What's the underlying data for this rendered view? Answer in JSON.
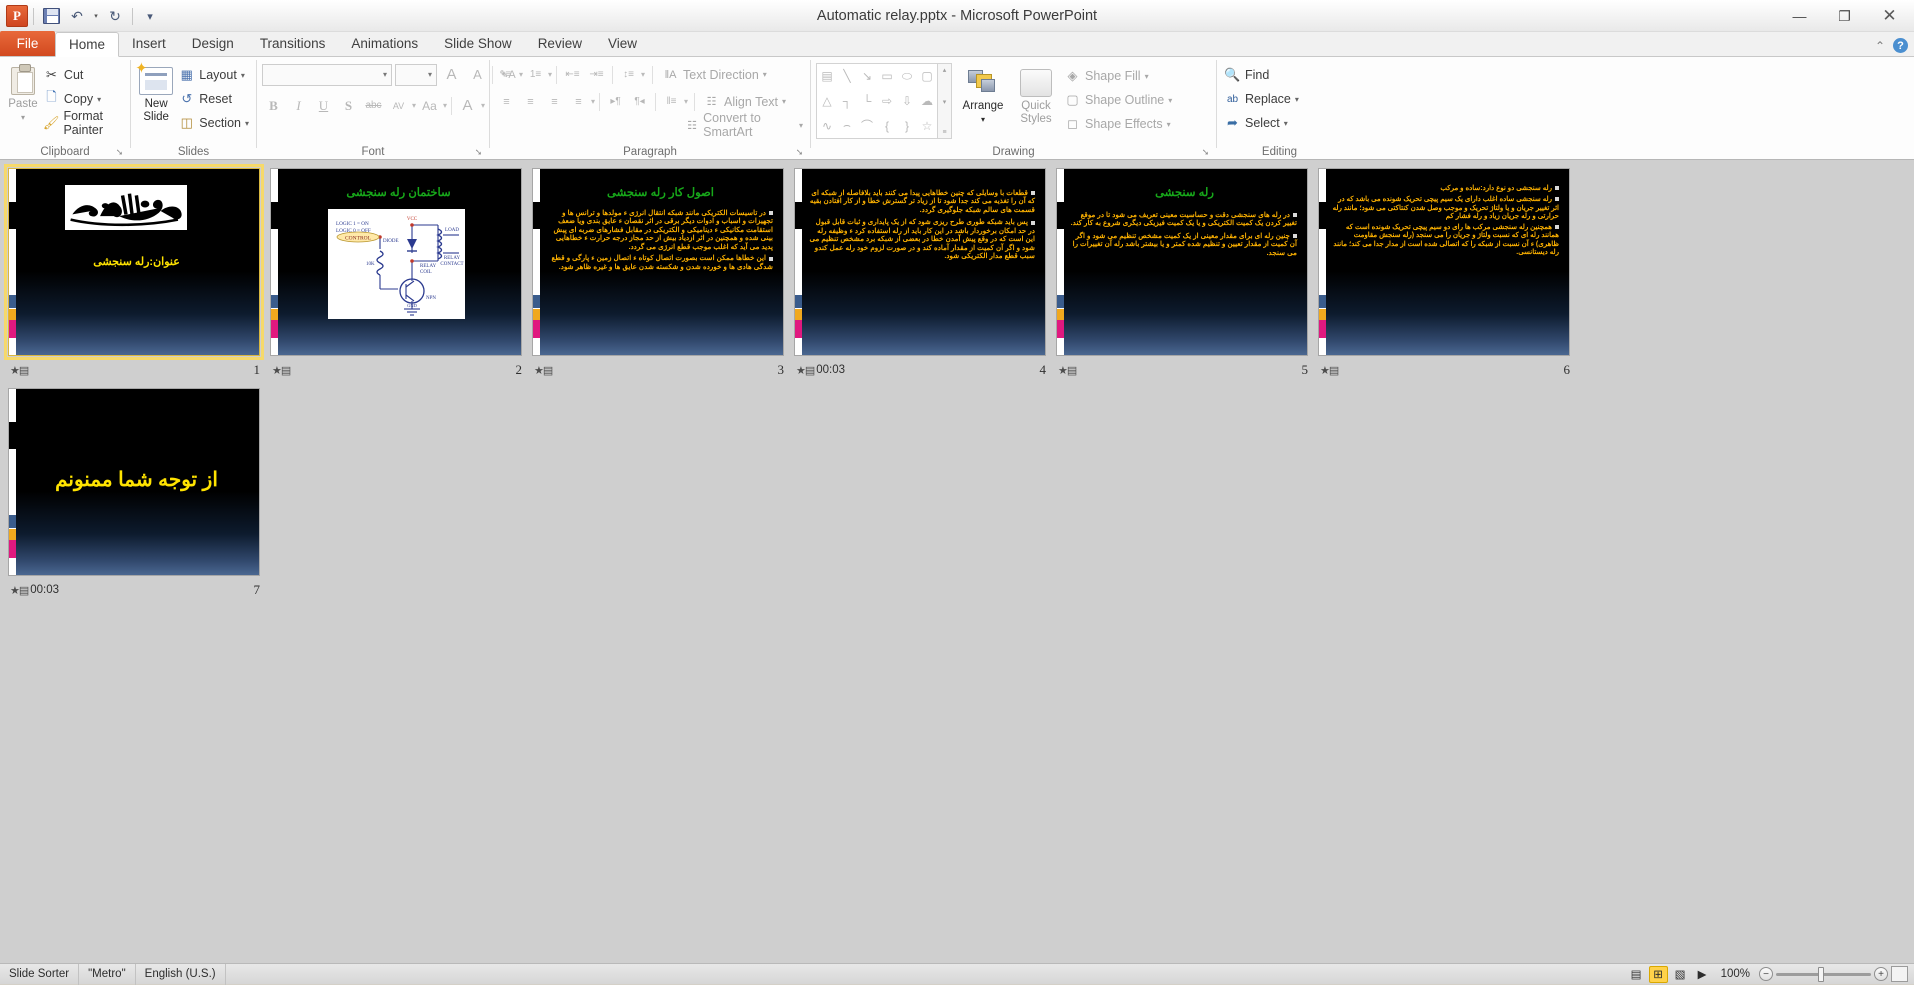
{
  "window": {
    "title": "Automatic relay.pptx  -  Microsoft PowerPoint",
    "minimize": "—",
    "restore": "❐",
    "close": "✕"
  },
  "quick_access": {
    "app_logo": "P",
    "save": "save-icon",
    "undo": "↶",
    "undo_arrow": "▾",
    "redo": "↻",
    "customize": "▾"
  },
  "tabs": [
    {
      "label": "File",
      "active": false,
      "file": true
    },
    {
      "label": "Home",
      "active": true
    },
    {
      "label": "Insert",
      "active": false
    },
    {
      "label": "Design",
      "active": false
    },
    {
      "label": "Transitions",
      "active": false
    },
    {
      "label": "Animations",
      "active": false
    },
    {
      "label": "Slide Show",
      "active": false
    },
    {
      "label": "Review",
      "active": false
    },
    {
      "label": "View",
      "active": false
    }
  ],
  "tab_right": {
    "minimize_ribbon": "⌃",
    "help": "?"
  },
  "ribbon": {
    "clipboard": {
      "label": "Clipboard",
      "paste": "Paste",
      "paste_arrow": "▾",
      "cut": "Cut",
      "copy": "Copy",
      "copy_arrow": "▾",
      "format_painter": "Format Painter",
      "launcher": "➘"
    },
    "slides": {
      "label": "Slides",
      "new_slide": "New\nSlide",
      "new_slide_line1": "New",
      "new_slide_line2": "Slide",
      "new_slide_arrow": "▾",
      "layout": "Layout",
      "reset": "Reset",
      "section": "Section",
      "layout_arrow": "▾",
      "section_arrow": "▾"
    },
    "font": {
      "label": "Font",
      "font_name_value": "",
      "font_size_value": "",
      "grow_font": "A",
      "shrink_font": "A",
      "clear_formatting": "A⊘",
      "bold": "B",
      "italic": "I",
      "underline": "U",
      "shadow": "S",
      "strikethrough": "abc",
      "character_spacing": "AV",
      "change_case": "Aa",
      "font_color": "A",
      "launcher": "➘"
    },
    "paragraph": {
      "label": "Paragraph",
      "bullets": "•≡",
      "numbering": "1≡",
      "decrease_indent": "⇤≡",
      "increase_indent": "⇥≡",
      "line_spacing": "↕≡",
      "align_left": "≡",
      "align_center": "≡",
      "align_right": "≡",
      "justify": "≡",
      "ltr": "▸¶",
      "rtl": "¶◂",
      "columns": "‖≡",
      "text_direction": "Text Direction",
      "align_text": "Align Text",
      "convert_to_smartart": "Convert to SmartArt",
      "launcher": "➘"
    },
    "drawing": {
      "label": "Drawing",
      "shapes": [
        "▤",
        "╲",
        "↘",
        "▭",
        "⬭",
        "▢",
        "△",
        "┐",
        "└",
        "⇨",
        "⇩",
        "☁",
        "∿",
        "⌢",
        "⌒",
        "{",
        "}",
        "☆"
      ],
      "gallery_up": "▴",
      "gallery_down": "▾",
      "gallery_more": "≡",
      "arrange": "Arrange",
      "arrange_arrow": "▾",
      "quick_styles_line1": "Quick",
      "quick_styles_line2": "Styles",
      "quick_styles_arrow": "▾",
      "shape_fill": "Shape Fill",
      "shape_outline": "Shape Outline",
      "shape_effects": "Shape Effects",
      "launcher": "➘"
    },
    "editing": {
      "label": "Editing",
      "find": "Find",
      "replace": "Replace",
      "select": "Select",
      "replace_arrow": "▾",
      "select_arrow": "▾"
    }
  },
  "slides": [
    {
      "number": "1",
      "time": "",
      "selected": true,
      "title": "عنوان:رله سنجشی",
      "title_color": "yellow",
      "has_bismillah": true,
      "body": []
    },
    {
      "number": "2",
      "time": "",
      "selected": false,
      "title": "ساختمان رله سنجشی",
      "title_color": "green",
      "has_circuit": true,
      "circuit_labels": {
        "vcc": "VCC",
        "diode": "DIODE",
        "logic1": "LOGIC 1 = ON",
        "logic0": "LOGIC 0 = OFF",
        "control": "CONTROL",
        "resistor": "10K",
        "relay_coil_l1": "RELAY",
        "relay_coil_l2": "COIL",
        "load": "LOAD",
        "relay_contact_l1": "RELAY",
        "relay_contact_l2": "CONTACT",
        "npn": "NPN",
        "gnd": "GND"
      },
      "body": []
    },
    {
      "number": "3",
      "time": "",
      "selected": false,
      "title": "اصول کار رله سنجشی",
      "title_color": "green",
      "body": [
        "در تاسیسات الکتریکی مانند شبکه انتقال انرژی ء مولدها و ترانس ها و تجهیزات و اسباب و ادوات دیگر برقی در اثر نقصان ء عایق بندی ویا ضعف استقامت مکانیکی ء دینامیکی و الکتریکی در مقابل فشارهای ضربه ای پیش بینی شده و همچنین در اثر ازدیاد بیش از حد مجاز درجه حرارت ء خطاهایی پدید می آید که اغلب موجب قطع انرژی می گردد.",
        "این خطاها ممکن است بصورت اتصال کوتاه ء اتصال زمین ء پارگی و قطع شدگی هادی ها و خورده شدن و شکسته شدن عایق ها و غیره ظاهر شود."
      ]
    },
    {
      "number": "4",
      "time": "00:03",
      "selected": false,
      "title": "",
      "title_color": "yellow",
      "body": [
        "قطعات  با وسایلی که چنین خطاهایی پیدا می کنند باید بلافاصله از شبکه ای که   آن را تغذیه می کند جدا شود تا از زیاد تر گسترش خطا و از کار افتادن بقیه قسمت های سالم شبکه جلوگیری گردد.",
        "پس باید شبکه طوری طرح ریزی شود که   از یک  پایداری و ثبات قابل قبول در حد امکان برخوردار باشد در این کار باید از رله استفاده کرد ء وظیفه رله این است که در وقع پیش آمدن خطا در بعضی از شبکه برد مشخص تنظیم می شود و اگر آن کمیت از مقدار آماده کند و در صورت لزوم خود رله عمل کندو سبب قطع مدار الکتریکی شود."
      ]
    },
    {
      "number": "5",
      "time": "",
      "selected": false,
      "title": "رله سنجشی",
      "title_color": "green",
      "body": [
        "در رله های سنجشی دقت و حساسیت معینی تعریف می شود تا در موقع تغییر کردن یک کمیت الکتریکی و یا یک کمیت فیزیکی دیگری شروع به کار کند.",
        "چنین رله ای برای مقدار معینی از یک کمیت مشخص تنظیم می شود  و اگر  آن کمیت از مقدار تعیین و تنظیم شده کمتر و یا بیشتر باشد رله آن تغییرات را می سنجد."
      ]
    },
    {
      "number": "6",
      "time": "",
      "selected": false,
      "title": "",
      "title_color": "yellow",
      "body": [
        "رله سنجشی دو نوع دارد:ساده و مرکب",
        "رله سنجشی ساده اغلب دارای یک سیم پیچی تحریک شونده می باشد که در اثر تغییر جریان و یا ولتاژ تحریک و موجب وصل شدن کنتاکتی می شود؛ مانند رله حرارتی و رله جریان زیاد و رله فشار کم",
        "همچنین رله سنجشی مرکب ها رای دو سیم پیچی تحریک شونده است که همانند رله ای که نسبت ولتاژ و جریان را می سنجد (رله سنجش مقاومت ظاهری) ء آن نسبت از شبکه را که اتصالی شده است از مدار جدا می کند؛ مانند رله دیستانسی."
      ]
    },
    {
      "number": "7",
      "time": "00:03",
      "selected": false,
      "title": "از توجه شما ممنونم",
      "title_color": "yellow",
      "big_thanks": true,
      "body": []
    }
  ],
  "status_bar": {
    "view_name": "Slide Sorter",
    "theme": "\"Metro\"",
    "language": "English (U.S.)",
    "zoom_level": "100%",
    "views": [
      {
        "name": "normal-view",
        "glyph": "▤",
        "active": false
      },
      {
        "name": "slide-sorter-view",
        "glyph": "⊞",
        "active": true
      },
      {
        "name": "reading-view",
        "glyph": "▧",
        "active": false
      },
      {
        "name": "slide-show-view",
        "glyph": "▶",
        "active": false
      }
    ],
    "zoom_out": "−",
    "zoom_in": "+",
    "fit_to_window": "⬚"
  }
}
